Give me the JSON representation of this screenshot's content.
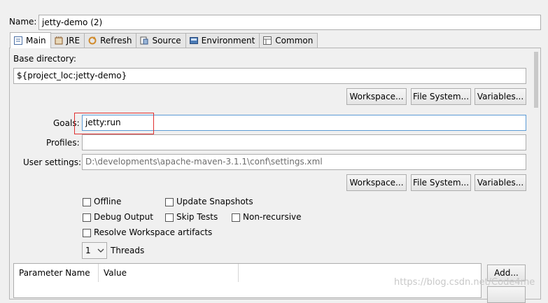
{
  "name_label": "Name:",
  "name_value": "jetty-demo (2)",
  "tabs": [
    {
      "label": "Main",
      "icon": "main-tab-icon"
    },
    {
      "label": "JRE",
      "icon": "jre-tab-icon"
    },
    {
      "label": "Refresh",
      "icon": "refresh-tab-icon"
    },
    {
      "label": "Source",
      "icon": "source-tab-icon"
    },
    {
      "label": "Environment",
      "icon": "environment-tab-icon"
    },
    {
      "label": "Common",
      "icon": "common-tab-icon"
    }
  ],
  "base_directory": {
    "label": "Base directory:",
    "value": "${project_loc:jetty-demo}"
  },
  "buttons": {
    "workspace": "Workspace...",
    "file_system": "File System...",
    "variables": "Variables...",
    "add": "Add..."
  },
  "goals": {
    "label": "Goals:",
    "value": "jetty:run"
  },
  "profiles": {
    "label": "Profiles:",
    "value": ""
  },
  "user_settings": {
    "label": "User settings:",
    "value": "D:\\developments\\apache-maven-3.1.1\\conf\\settings.xml"
  },
  "options": {
    "offline": "Offline",
    "update_snapshots": "Update Snapshots",
    "debug_output": "Debug Output",
    "skip_tests": "Skip Tests",
    "non_recursive": "Non-recursive",
    "resolve_workspace": "Resolve Workspace artifacts"
  },
  "threads": {
    "value": "1",
    "label": "Threads"
  },
  "parameters_table": {
    "columns": [
      "Parameter Name",
      "Value"
    ]
  },
  "watermark": "https://blog.csdn.net/Code4me",
  "colors": {
    "highlight_box": "#e03030",
    "focus_border": "#5b9bd5"
  }
}
